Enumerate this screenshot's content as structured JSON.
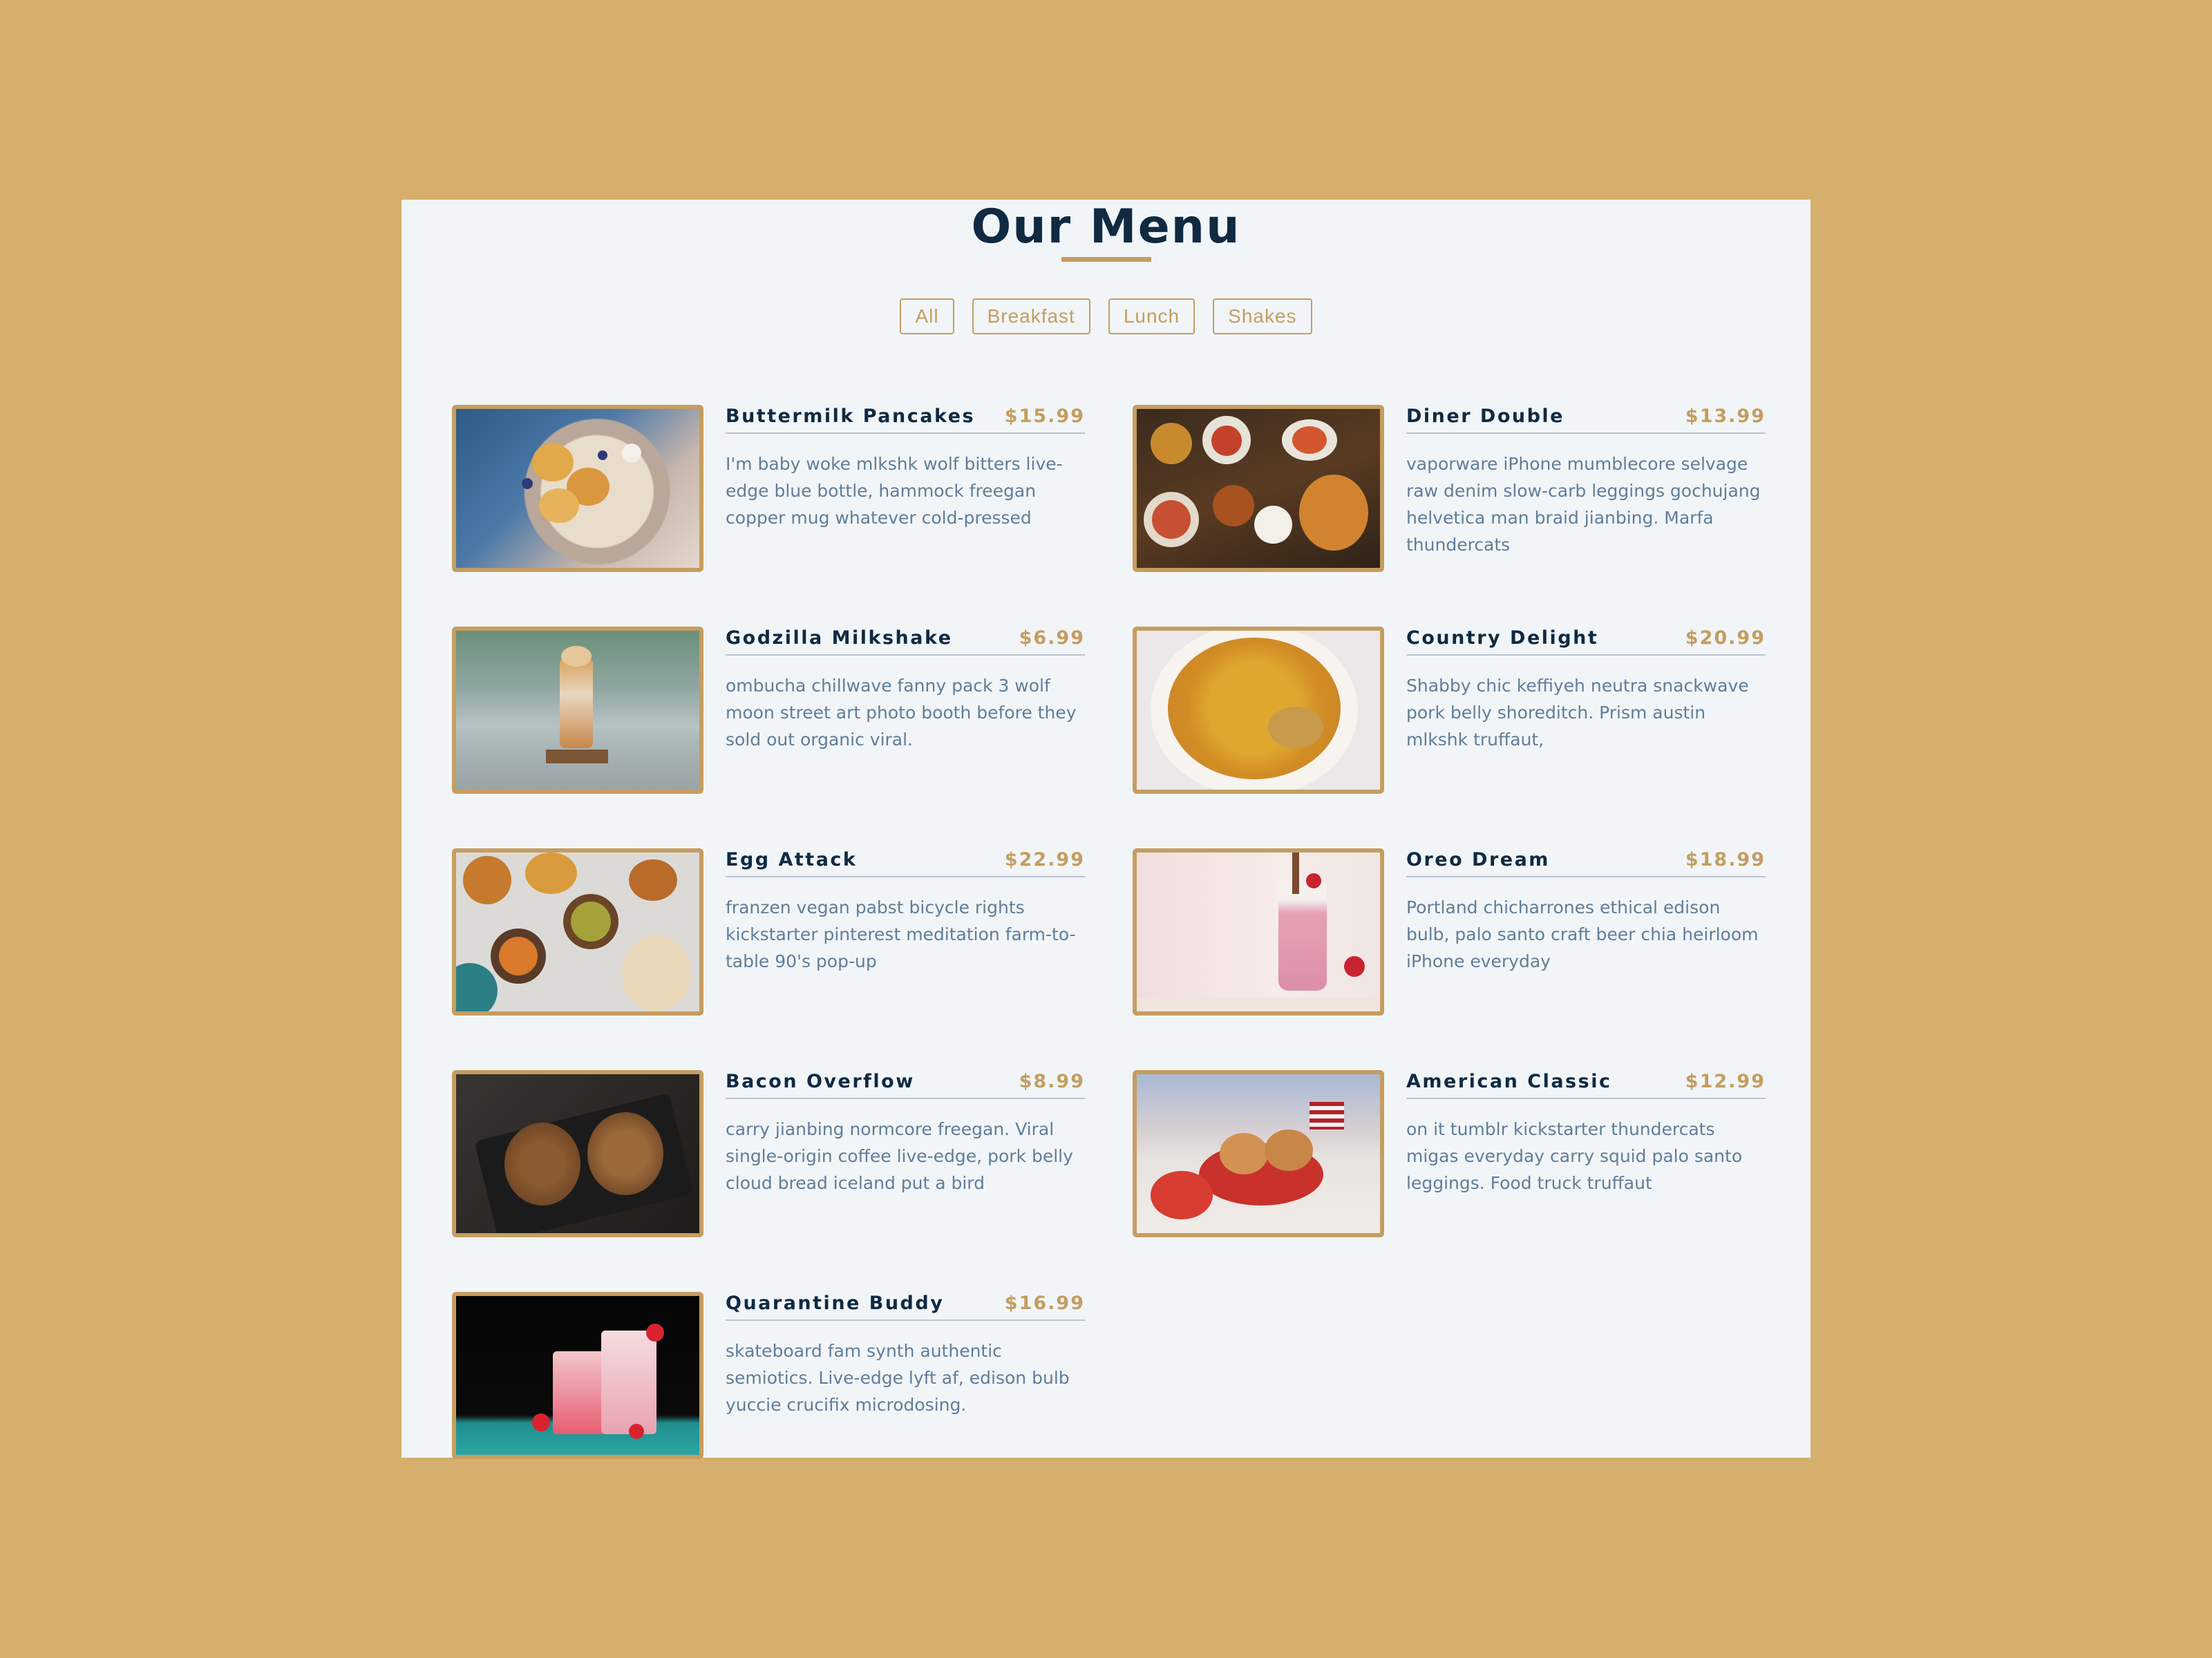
{
  "header": {
    "title": "Our Menu"
  },
  "filters": [
    "All",
    "Breakfast",
    "Lunch",
    "Shakes"
  ],
  "colors": {
    "background": "#d6af6c",
    "page": "#f1f5f8",
    "accent": "#c59d5f",
    "heading": "#102a42",
    "text": "#617d98"
  },
  "items": [
    {
      "name": "Buttermilk Pancakes",
      "price": "$15.99",
      "desc": "I'm baby woke mlkshk wolf bitters live-edge blue bottle, hammock freegan copper mug whatever cold-pressed",
      "image": "pancakes-photo"
    },
    {
      "name": "Diner Double",
      "price": "$13.99",
      "desc": "vaporware iPhone mumblecore selvage raw denim slow-carb leggings gochujang helvetica man braid jianbing. Marfa thundercats",
      "image": "spread-photo"
    },
    {
      "name": "Godzilla Milkshake",
      "price": "$6.99",
      "desc": "ombucha chillwave fanny pack 3 wolf moon street art photo booth before they sold out organic viral.",
      "image": "milkshake-photo"
    },
    {
      "name": "Country Delight",
      "price": "$20.99",
      "desc": "Shabby chic keffiyeh neutra snackwave pork belly shoreditch. Prism austin mlkshk truffaut,",
      "image": "rice-plate-photo"
    },
    {
      "name": "Egg Attack",
      "price": "$22.99",
      "desc": "franzen vegan pabst bicycle rights kickstarter pinterest meditation farm-to-table 90's pop-up",
      "image": "curry-bowls-photo"
    },
    {
      "name": "Oreo Dream",
      "price": "$18.99",
      "desc": "Portland chicharrones ethical edison bulb, palo santo craft beer chia heirloom iPhone everyday",
      "image": "pink-shake-photo"
    },
    {
      "name": "Bacon Overflow",
      "price": "$8.99",
      "desc": "carry jianbing normcore freegan. Viral single-origin coffee live-edge, pork belly cloud bread iceland put a bird",
      "image": "sandwich-photo"
    },
    {
      "name": "American Classic",
      "price": "$12.99",
      "desc": "on it tumblr kickstarter thundercats migas everyday carry squid palo santo leggings. Food truck truffaut",
      "image": "burgers-photo"
    },
    {
      "name": "Quarantine Buddy",
      "price": "$16.99",
      "desc": "skateboard fam synth authentic semiotics. Live-edge lyft af, edison bulb yuccie crucifix microdosing.",
      "image": "smoothie-photo"
    }
  ]
}
